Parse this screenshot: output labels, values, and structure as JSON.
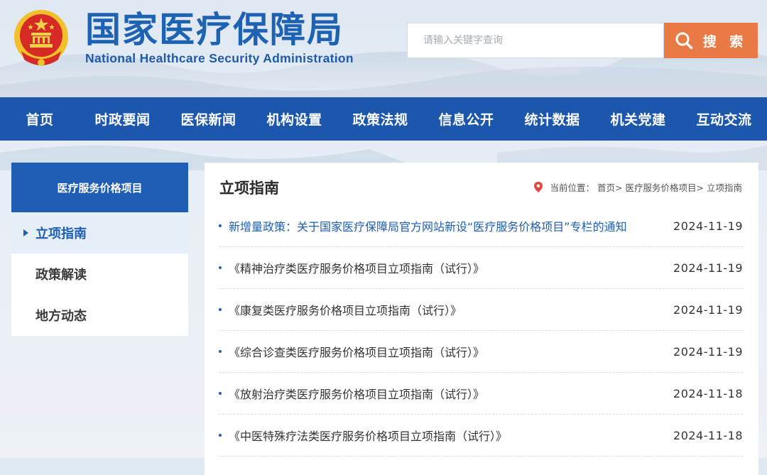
{
  "header": {
    "title_cn": "国家医疗保障局",
    "title_en": "National Healthcare Security Administration",
    "search_placeholder": "请输入关键字查询",
    "search_button": "搜 索"
  },
  "nav": {
    "items": [
      "首页",
      "时政要闻",
      "医保新闻",
      "机构设置",
      "政策法规",
      "信息公开",
      "统计数据",
      "机关党建",
      "互动交流"
    ]
  },
  "sidebar": {
    "heading": "医疗服务价格项目",
    "items": [
      "立项指南",
      "政策解读",
      "地方动态"
    ],
    "active_index": 0
  },
  "content": {
    "title": "立项指南",
    "breadcrumb": {
      "prefix": "当前位置：",
      "crumbs": [
        "首页>",
        "医疗服务价格项目>",
        "立项指南"
      ]
    },
    "articles": [
      {
        "title": "新增量政策：关于国家医疗保障局官方网站新设“医疗服务价格项目”专栏的通知",
        "date": "2024-11-19"
      },
      {
        "title": "《精神治疗类医疗服务价格项目立项指南（试行）》",
        "date": "2024-11-19"
      },
      {
        "title": "《康复类医疗服务价格项目立项指南（试行）》",
        "date": "2024-11-19"
      },
      {
        "title": "《综合诊查类医疗服务价格项目立项指南（试行）》",
        "date": "2024-11-19"
      },
      {
        "title": "《放射治疗类医疗服务价格项目立项指南（试行）》",
        "date": "2024-11-18"
      },
      {
        "title": "《中医特殊疗法类医疗服务价格项目立项指南（试行）》",
        "date": "2024-11-18"
      }
    ]
  },
  "colors": {
    "brand_blue": "#1c57ad",
    "search_orange": "#ea7a45",
    "location_red": "#e2473b"
  }
}
